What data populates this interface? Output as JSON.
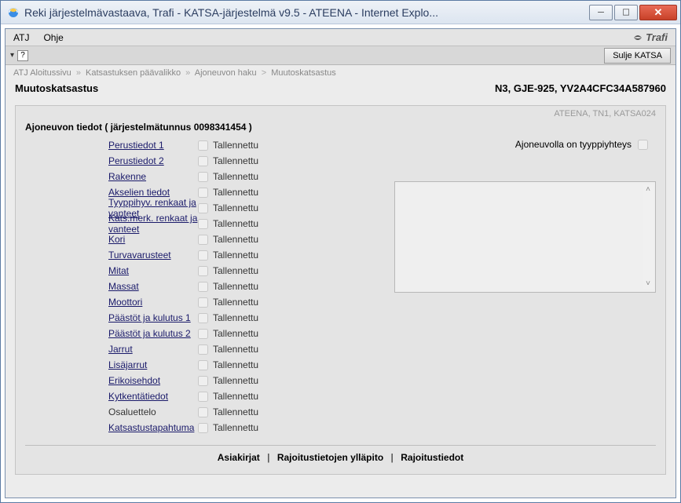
{
  "window": {
    "title": "Reki järjestelmävastaava, Trafi - KATSA-järjestelmä v9.5 - ATEENA - Internet Explo..."
  },
  "menubar": {
    "menu1": "ATJ",
    "menu2": "Ohje",
    "brand": "Trafi"
  },
  "toolbar": {
    "help_glyph": "?",
    "close_system": "Sulje KATSA"
  },
  "breadcrumb": {
    "b1": "ATJ Aloitussivu",
    "b2": "Katsastuksen päävalikko",
    "b3": "Ajoneuvon haku",
    "b4": "Muutoskatsastus"
  },
  "header": {
    "page_title": "Muutoskatsastus",
    "vehicle_id": "N3, GJE-925, YV2A4CFC34A587960"
  },
  "panel": {
    "meta": "ATEENA, TN1, KATSA024",
    "section_title": "Ajoneuvon tiedot  ( järjestelmätunnus 0098341454 )",
    "status_label": "Tallennettu",
    "type_conn_label": "Ajoneuvolla on tyyppiyhteys",
    "rows": [
      {
        "label": "Perustiedot 1",
        "link": true
      },
      {
        "label": "Perustiedot 2",
        "link": true
      },
      {
        "label": "Rakenne",
        "link": true
      },
      {
        "label": "Akselien tiedot",
        "link": true
      },
      {
        "label": "Tyyppihyv. renkaat ja vanteet",
        "link": true
      },
      {
        "label": "Kats.merk. renkaat ja vanteet",
        "link": true
      },
      {
        "label": "Kori",
        "link": true
      },
      {
        "label": "Turvavarusteet",
        "link": true
      },
      {
        "label": "Mitat",
        "link": true
      },
      {
        "label": "Massat",
        "link": true
      },
      {
        "label": "Moottori",
        "link": true
      },
      {
        "label": "Päästöt ja kulutus 1",
        "link": true
      },
      {
        "label": "Päästöt ja kulutus 2",
        "link": true
      },
      {
        "label": "Jarrut",
        "link": true
      },
      {
        "label": "Lisäjarrut",
        "link": true
      },
      {
        "label": "Erikoisehdot",
        "link": true
      },
      {
        "label": "Kytkentätiedot",
        "link": true
      },
      {
        "label": "Osaluettelo",
        "link": false
      },
      {
        "label": "Katsastustapahtuma",
        "link": true
      }
    ]
  },
  "footer": {
    "l1": "Asiakirjat",
    "l2": "Rajoitustietojen ylläpito",
    "l3": "Rajoitustiedot"
  }
}
